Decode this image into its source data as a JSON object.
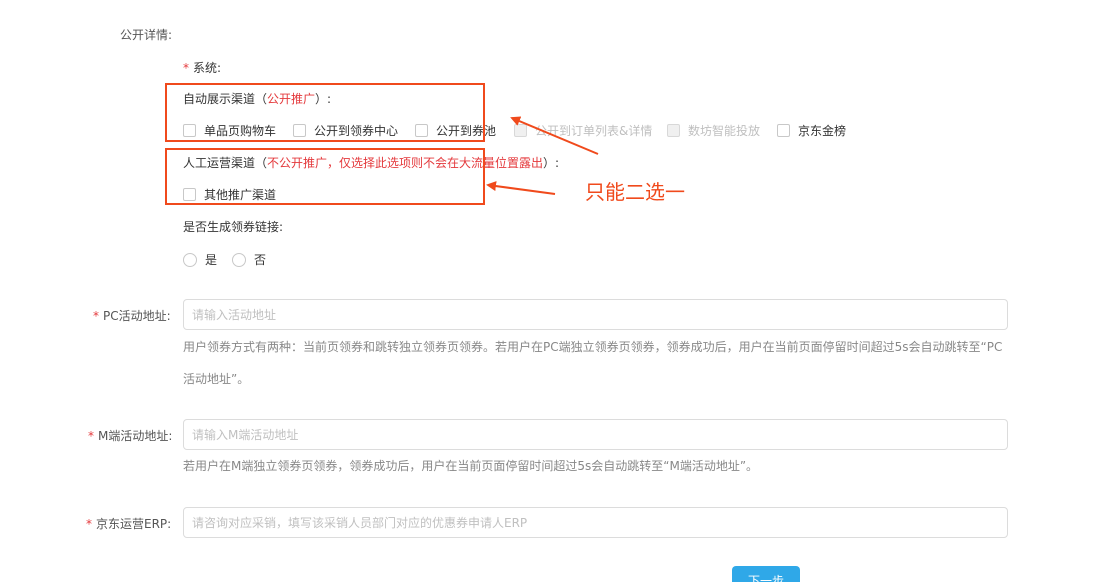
{
  "public_details": {
    "label": "公开详情:"
  },
  "system": {
    "required_mark": "*",
    "label": "系统:"
  },
  "auto_channel": {
    "label_prefix": "自动展示渠道（",
    "label_highlight": "公开推广",
    "label_suffix": "）:",
    "options": [
      {
        "label": "单品页购物车",
        "disabled": false
      },
      {
        "label": "公开到领券中心",
        "disabled": false
      },
      {
        "label": "公开到券池",
        "disabled": false
      },
      {
        "label": "公开到订单列表&详情",
        "disabled": true
      },
      {
        "label": "数坊智能投放",
        "disabled": true
      },
      {
        "label": "京东金榜",
        "disabled": false
      }
    ]
  },
  "manual_channel": {
    "label_prefix": "人工运营渠道（",
    "label_highlight": "不公开推广，仅选择此选项则不会在大流量位置露出",
    "label_suffix": "）:",
    "options": [
      {
        "label": "其他推广渠道",
        "disabled": false
      }
    ]
  },
  "annotation": {
    "text": "只能二选一",
    "color": "#f04a1c"
  },
  "coupon_link": {
    "label": "是否生成领券链接:",
    "options": [
      "是",
      "否"
    ]
  },
  "pc_url": {
    "required_mark": "*",
    "label": "PC活动地址:",
    "placeholder": "请输入活动地址",
    "help_line1": "用户领券方式有两种：当前页领券和跳转独立领券页领券。若用户在PC端独立领券页领券，领券成功后，用户在当前页面停留时间超过5s会自动跳转至“PC",
    "help_line2": "活动地址”。"
  },
  "m_url": {
    "required_mark": "*",
    "label": "M端活动地址:",
    "placeholder": "请输入M端活动地址",
    "help": "若用户在M端独立领券页领券，领券成功后，用户在当前页面停留时间超过5s会自动跳转至“M端活动地址”。"
  },
  "erp": {
    "required_mark": "*",
    "label": "京东运营ERP:",
    "placeholder": "请咨询对应采销，填写该采销人员部门对应的优惠券申请人ERP"
  },
  "next_button": {
    "label": "下一步"
  },
  "colors": {
    "accent": "#2fa8e8",
    "required": "#e4393c",
    "annotation": "#f04a1c"
  }
}
